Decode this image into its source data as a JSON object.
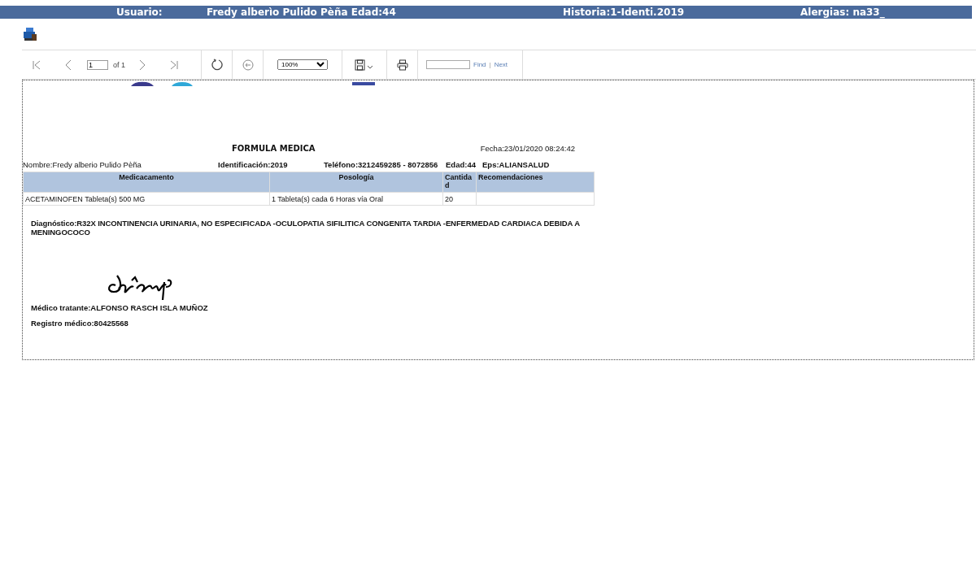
{
  "header": {
    "user_label": "Usuario:",
    "patient": "Fredy alberìo Pulido Pèña Edad:44",
    "history": "Historia:1-Identi.2019",
    "allergies": "Alergias: na33_"
  },
  "toolbar": {
    "page_value": "1",
    "page_of": "of 1",
    "zoom": "100%",
    "find": "Find",
    "separator": "|",
    "next": "Next"
  },
  "report": {
    "title": "FORMULA MEDICA",
    "date": "Fecha:23/01/2020 08:24:42",
    "patient_fields": [
      "Nombre:Fredy alberio Pulido  Pèña",
      "Identificación:2019",
      "Teléfono:3212459285 - 8072856",
      "Edad:44",
      "Eps:ALIANSALUD"
    ],
    "table": {
      "columns": [
        "Medicacamento",
        "Posología",
        "Cantidad",
        "Recomendaciones"
      ],
      "rows": [
        [
          "ACETAMINOFEN Tableta(s) 500 MG",
          "1 Tableta(s) cada 6 Horas vía Oral",
          "20",
          null
        ]
      ]
    },
    "diagnosis": "Diagnóstico:R32X INCONTINENCIA URINARIA, NO ESPECIFICADA -OCULOPATIA SIFILITICA CONGENITA TARDIA -ENFERMEDAD CARDIACA DEBIDA A MENINGOCOCO",
    "doctor": "Médico tratante:ALFONSO RASCH ISLA MUÑOZ",
    "registry": "Registro médico:80425568"
  }
}
